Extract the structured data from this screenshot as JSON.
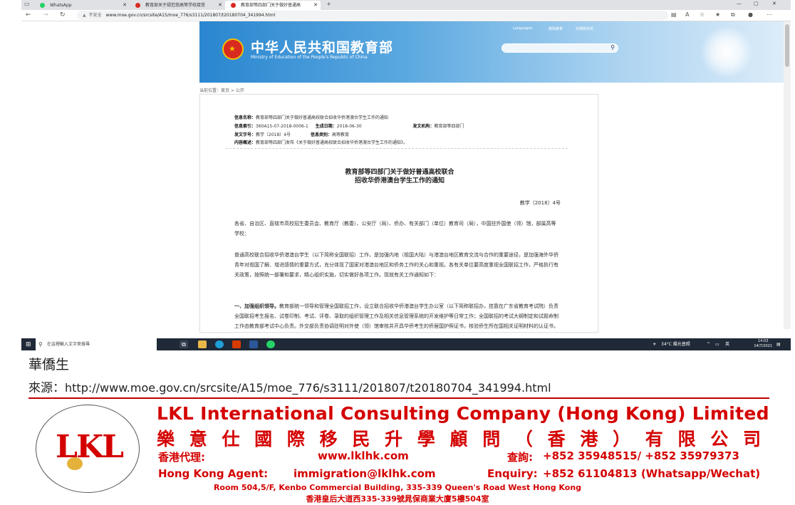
{
  "browser": {
    "tabs": [
      {
        "label": "WhatsApp",
        "icon": "whatsapp-icon",
        "color": "#25d366"
      },
      {
        "label": "教育部关于规范我高等学校接受",
        "icon": "moe-favicon",
        "color": "#d92a20"
      },
      {
        "label": "教育部等四部门关于做好普通高",
        "icon": "moe-favicon",
        "color": "#d92a20"
      }
    ],
    "new_tab": "+",
    "security": "不安全",
    "url": "www.moe.gov.cn/srcsite/A15/moe_776/s3111/201807/t20180704_341994.html"
  },
  "site": {
    "top_links": [
      "Languages",
      "微政教育",
      "无障碍浏览"
    ],
    "title": "中华人民共和国教育部",
    "subtitle": "Ministry of Education of the People's Republic of China",
    "breadcrumb": "当前位置：首页 > 公开"
  },
  "doc": {
    "info_name_label": "信息名称：",
    "info_name": "教育部等四部门关于做好普通高校联合招收华侨港澳台学生工作的通知",
    "index_label": "信息索引：",
    "index": "360A15-07-2018-0006-1",
    "date_label": "生成日期：",
    "date": "2018-06-30",
    "org_label": "发文机构：",
    "org": "教育部等四部门",
    "docno_label": "发文字号：",
    "docno": "教学〔2018〕4号",
    "category_label": "信息类别：",
    "category": "高等教育",
    "summary_label": "内容概述：",
    "summary": "教育部等四部门发布《关于做好普通高校联合招收华侨港澳台学生工作的通知》。",
    "title_line1": "教育部等四部门关于做好普通高校联合",
    "title_line2": "招收华侨港澳台学生工作的通知",
    "doc_number": "教学〔2018〕4号",
    "para1": "各省、自治区、直辖市高校招生委员会、教育厅（教委）、公安厅（局）、侨办、有关部门（单位）教育司（局），中国驻外国使（领）馆，部属高等学校：",
    "para2": "普通高校联合招收华侨港澳台学生（以下简称全国联招）工作，是加强内地（祖国大陆）与港澳台地区教育交流与合作的重要途径，是加强海外华侨青年对祖国了解、增进感情的重要方式，充分体现了国家对港澳台地区和侨务工作的关心和重视。各有关单位要高度重视全国联招工作，严格执行有关政策，按照统一部署和要求，精心组织实施，切实做好各项工作。现就有关工作通知如下：",
    "para3_head": "一、加强组织领导。",
    "para3": "教育部统一领导和管理全国联招工作，设立联合招收华侨港澳台学生办公室（以下简称联招办，挂靠在广东省教育考试院）负责全国联招考生报名、试卷印制、考试、评卷、录取的组织管理工作及相关信息管理系统的开发维护等日常工作；全国联招的考试大纲制定和试题命制工作由教育部考试中心负责。外交部负责协调驻明对外使（领）馆审核并开具华侨考生的侨居国护照证书，核验侨生所在国相关证明材料的认证书，公"
  },
  "taskbar": {
    "search_placeholder": "在這裡輸入文字來搜尋",
    "weather": "34°C 陽光普照",
    "ime": "英",
    "time": "14:03",
    "date": "14/7/2021"
  },
  "caption": {
    "label": "華僑生",
    "source_label": "來源：",
    "source_url": "http://www.moe.gov.cn/srcsite/A15/moe_776/s3111/201807/t20180704_341994.html"
  },
  "company": {
    "name_en": "LKL International Consulting Company (Hong Kong) Limited",
    "name_zh": [
      "樂",
      "意",
      "仕",
      "國",
      "際",
      "移",
      "民",
      "升",
      "學",
      "顧",
      "問",
      "（",
      "香",
      "港",
      "）",
      "有",
      "限",
      "公",
      "司"
    ],
    "agent_zh": "香港代理:",
    "agent_en": "Hong Kong Agent:",
    "website": "www.lklhk.com",
    "email": "immigration@lklhk.com",
    "enquiry_zh": "查詢:",
    "enquiry_en": "Enquiry:",
    "phone_zh": "+852 35948515/ +852 35979373",
    "phone_en": "+852 61104813 (Whatsapp/Wechat)",
    "address_en": "Room 504,5/F, Kenbo Commercial Building, 335-339 Queen's Road West Hong Kong",
    "address_zh": "香港皇后大道西335-339號晁保商業大廈5樓504室",
    "logo_text": "LKL",
    "accent": "#d40000"
  }
}
